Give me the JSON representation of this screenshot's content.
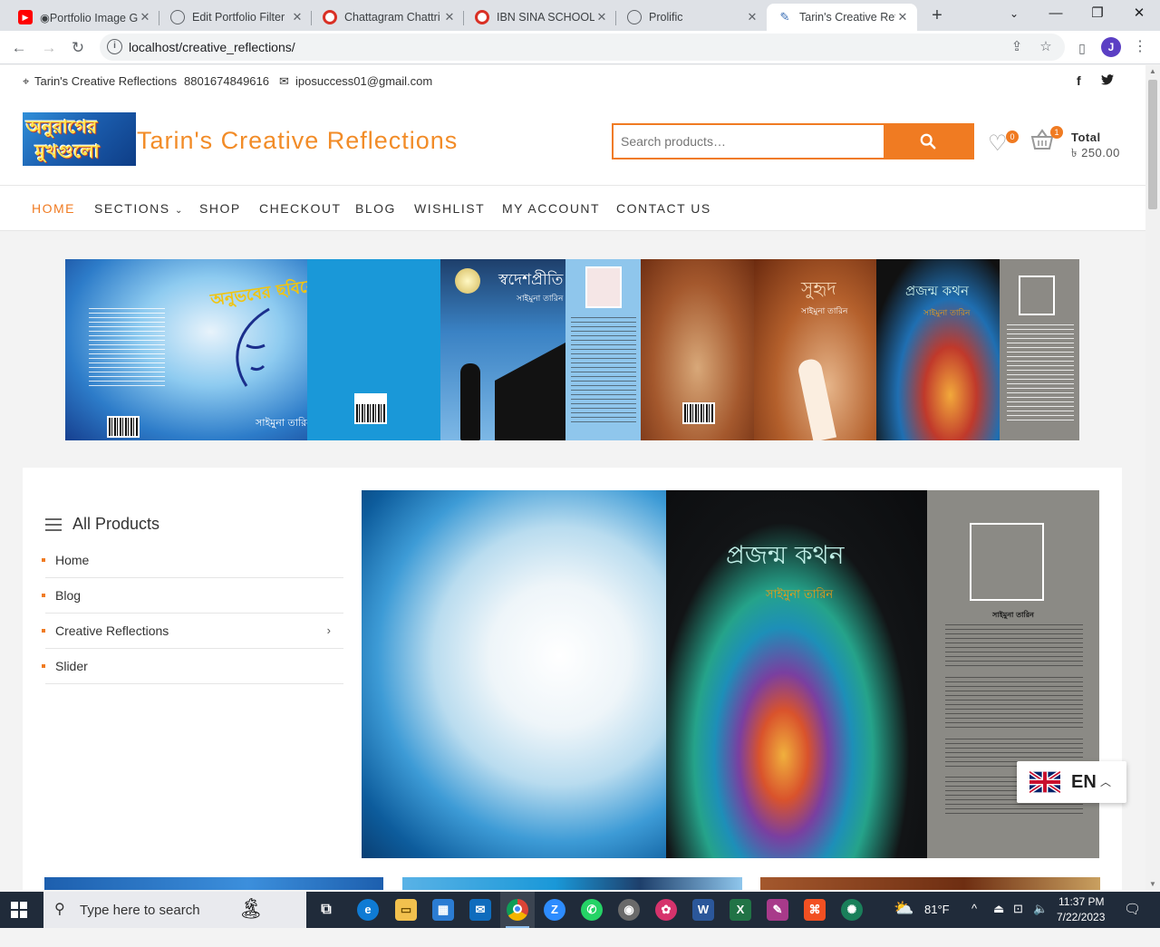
{
  "browser": {
    "tabs": [
      {
        "title": "◉Portfolio Image G",
        "favicon_color": "#ff0000",
        "favicon": "youtube-icon"
      },
      {
        "title": "Edit Portfolio Filter",
        "favicon_color": "#5f6368",
        "favicon": "globe-icon"
      },
      {
        "title": "Chattagram Chattri",
        "favicon_color": "#d93025",
        "favicon": "target-icon"
      },
      {
        "title": "IBN SINA SCHOOL",
        "favicon_color": "#d93025",
        "favicon": "target-icon"
      },
      {
        "title": "Prolific",
        "favicon_color": "#5f6368",
        "favicon": "globe-icon"
      },
      {
        "title": "Tarin's Creative Refl",
        "favicon_color": "#3b6fb6",
        "favicon": "pen-icon"
      }
    ],
    "active_tab_index": 5,
    "url": "localhost/creative_reflections/"
  },
  "topbar": {
    "location": "Tarin's Creative Reflections",
    "phone": "8801674849616",
    "email": "iposuccess01@gmail.com"
  },
  "header": {
    "logo_line1": "অনুরাগের",
    "logo_line2": "মুখগুলো",
    "site_title": "Tarin's Creative Reflections",
    "search_placeholder": "Search products…",
    "wishlist_count": "0",
    "cart_count": "1",
    "total_label": "Total",
    "total_value": "৳ 250.00"
  },
  "nav": {
    "items": [
      "HOME",
      "SECTIONS",
      "SHOP",
      "CHECKOUT",
      "BLOG",
      "WISHLIST",
      "MY ACCOUNT",
      "CONTACT US"
    ],
    "active": "HOME"
  },
  "banner": {
    "book1_title": "অনুভবের ছবিরেখা",
    "book2_title": "স্বদেশপ্রীতি",
    "book3_title": "সুহৃদ",
    "book4_title": "প্রজন্ম কথন",
    "author": "সাইমুনা তারিন"
  },
  "sidebar": {
    "heading": "All Products",
    "items": [
      "Home",
      "Blog",
      "Creative Reflections",
      "Slider"
    ]
  },
  "hero": {
    "title": "প্রজন্ম কথন",
    "author": "সাইমুনা তারিন",
    "back_author": "সাইমুনা তারিন"
  },
  "language": {
    "code": "EN"
  },
  "taskbar": {
    "search_placeholder": "Type here to search",
    "temperature": "81°F",
    "time": "11:37 PM",
    "date": "7/22/2023"
  }
}
